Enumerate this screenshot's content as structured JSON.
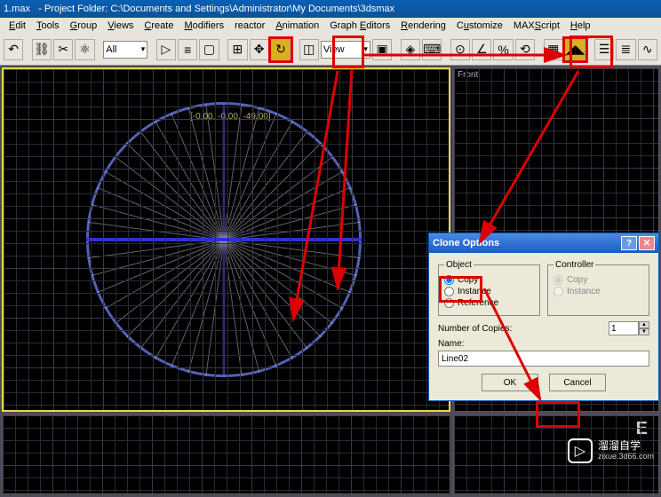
{
  "window": {
    "title": "1.max   - Project Folder: C:\\Documents and Settings\\Administrator\\My Documents\\3dsmax"
  },
  "menu": [
    "Edit",
    "Tools",
    "Group",
    "Views",
    "Create",
    "Modifiers",
    "reactor",
    "Animation",
    "Graph Editors",
    "Rendering",
    "Customize",
    "MAXScript",
    "Help"
  ],
  "toolbar": {
    "dropdown1": "All",
    "dropdown2": "View"
  },
  "viewport": {
    "front_label": "Front",
    "coords": "[-0.00, -0.00, -49.00]"
  },
  "dialog": {
    "title": "Clone Options",
    "object_legend": "Object",
    "controller_legend": "Controller",
    "copy": "Copy",
    "instance": "Instance",
    "reference": "Reference",
    "copies_label": "Number of Copies:",
    "copies_value": "1",
    "name_label": "Name:",
    "name_value": "Line02",
    "ok": "OK",
    "cancel": "Cancel"
  },
  "watermark": {
    "brand": "溜溜自学",
    "sub": "zixue.3d66.com"
  }
}
